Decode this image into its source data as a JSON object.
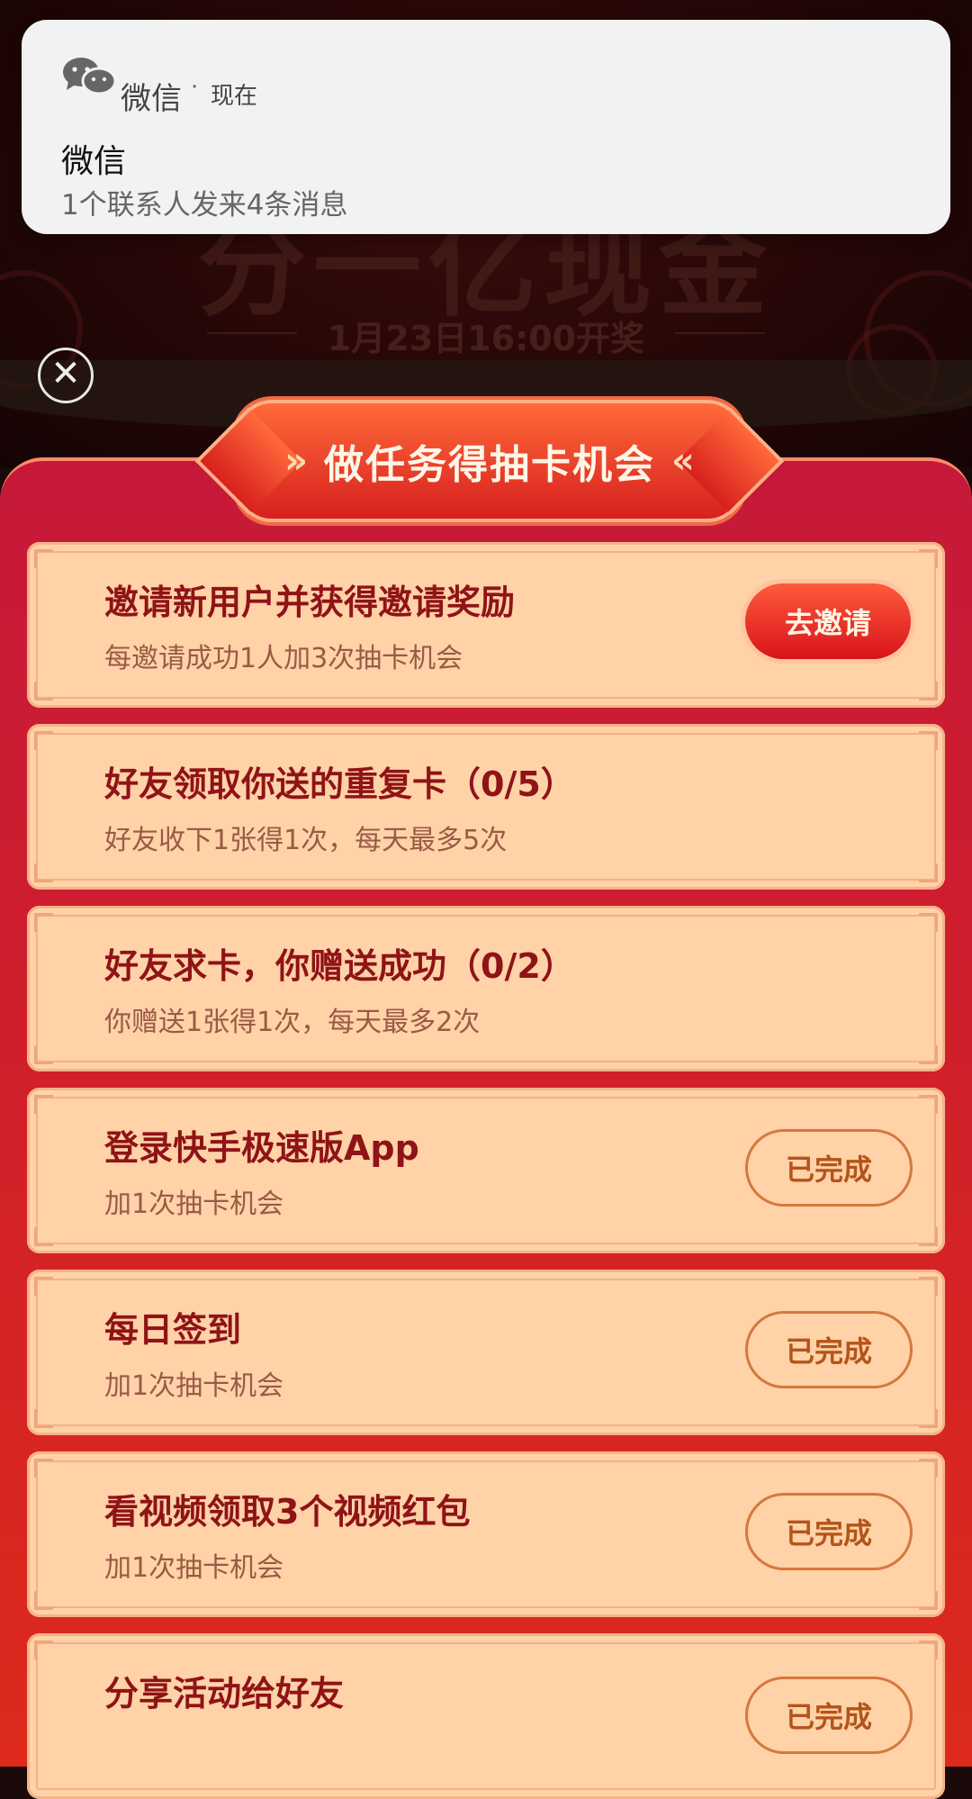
{
  "background": {
    "title": "分一亿现金",
    "date": "1月23日16:00开奖"
  },
  "notification": {
    "app_name": "微信",
    "separator": "·",
    "time": "现在",
    "title": "微信",
    "body": "1个联系人发来4条消息",
    "icon": "wechat-icon"
  },
  "close": {
    "glyph": "✕",
    "icon": "close-icon"
  },
  "panel": {
    "title": "做任务得抽卡机会",
    "left_deco": "»",
    "right_deco": "«"
  },
  "tasks": [
    {
      "title": "邀请新用户并获得邀请奖励",
      "subtitle": "每邀请成功1人加3次抽卡机会",
      "button": "去邀请"
    },
    {
      "title": "好友领取你送的重复卡（0/5）",
      "subtitle": "好友收下1张得1次，每天最多5次"
    },
    {
      "title": "好友求卡，你赠送成功（0/2）",
      "subtitle": "你赠送1张得1次，每天最多2次"
    },
    {
      "title": "登录快手极速版App",
      "subtitle": "加1次抽卡机会",
      "button": "已完成"
    },
    {
      "title": "每日签到",
      "subtitle": "加1次抽卡机会",
      "button": "已完成"
    },
    {
      "title": "看视频领取3个视频红包",
      "subtitle": "加1次抽卡机会",
      "button": "已完成"
    },
    {
      "title": "分享活动给好友",
      "subtitle": "",
      "button": "已完成"
    }
  ],
  "colors": {
    "panel_red": "#cf1e2c",
    "card_bg": "#ffd2a8",
    "title_text": "#8f1317",
    "done_text": "#b4541a"
  }
}
